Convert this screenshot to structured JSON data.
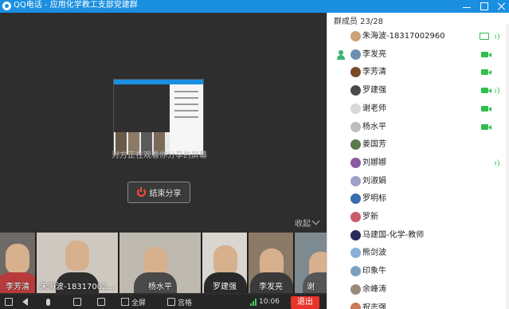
{
  "window": {
    "title": "QQ电话 - 应用化学教工支部党建群"
  },
  "main": {
    "sharing_text": "对方正在观看你分享的屏幕",
    "end_share_label": "结束分享",
    "collapse_label": "收起"
  },
  "videos": [
    {
      "name": "李芳清",
      "bg": "#6e6b66",
      "shirt": "#b83a3a"
    },
    {
      "name": "朱海波-18317002...",
      "bg": "#cfc8c0",
      "shirt": "#2d2d2d"
    },
    {
      "name": "杨水平",
      "bg": "#bfbab0",
      "shirt": "#4a4a4a"
    },
    {
      "name": "罗建强",
      "bg": "#d9d5cf",
      "shirt": "#2a2a2a"
    },
    {
      "name": "李发亮",
      "bg": "#8a7a66",
      "shirt": "#3a3a3a"
    },
    {
      "name": "谢",
      "bg": "#7d8a8f",
      "shirt": "#555555"
    }
  ],
  "controls": {
    "fullscreen_label": "全屏",
    "layout_label": "宫格",
    "time": "10:06",
    "hangup_label": "退出"
  },
  "members": {
    "header": "群成员 23/28",
    "items": [
      {
        "name": "朱海波-18317002960",
        "host": false,
        "icon": "screen-share",
        "volume": true,
        "avatar": "#c9a27a"
      },
      {
        "name": "李发亮",
        "host": true,
        "icon": "camera",
        "volume": false,
        "avatar": "#6f8fb0"
      },
      {
        "name": "李芳清",
        "host": false,
        "icon": "camera",
        "volume": false,
        "avatar": "#7a4a2a"
      },
      {
        "name": "罗建强",
        "host": false,
        "icon": "camera",
        "volume": true,
        "avatar": "#4a4a4a"
      },
      {
        "name": "谢老师",
        "host": false,
        "icon": "camera",
        "volume": false,
        "avatar": "#d8d8d8"
      },
      {
        "name": "杨水平",
        "host": false,
        "icon": "camera",
        "volume": false,
        "avatar": "#bdbdbd"
      },
      {
        "name": "姜国芳",
        "host": false,
        "icon": "",
        "volume": false,
        "avatar": "#5a7a4a"
      },
      {
        "name": "刘娜娜",
        "host": false,
        "icon": "",
        "volume": true,
        "avatar": "#8a5aa0"
      },
      {
        "name": "刘淑娟",
        "host": false,
        "icon": "",
        "volume": false,
        "avatar": "#a0a0c8"
      },
      {
        "name": "罗明标",
        "host": false,
        "icon": "",
        "volume": false,
        "avatar": "#3a6ab0"
      },
      {
        "name": "罗新",
        "host": false,
        "icon": "",
        "volume": false,
        "avatar": "#c85a6a"
      },
      {
        "name": "马建国-化学-教师",
        "host": false,
        "icon": "",
        "volume": false,
        "avatar": "#2a2a5a"
      },
      {
        "name": "熊剑波",
        "host": false,
        "icon": "",
        "volume": false,
        "avatar": "#8ab0d8"
      },
      {
        "name": "印象牛",
        "host": false,
        "icon": "",
        "volume": false,
        "avatar": "#7aa0c0"
      },
      {
        "name": "余峰涛",
        "host": false,
        "icon": "",
        "volume": false,
        "avatar": "#9a8a7a"
      },
      {
        "name": "祝志强",
        "host": false,
        "icon": "",
        "volume": false,
        "avatar": "#c87a5a"
      }
    ]
  },
  "colors": {
    "titlebar": "#1a8fe0",
    "accent_green": "#2fbf4a",
    "hangup": "#e8342a"
  }
}
